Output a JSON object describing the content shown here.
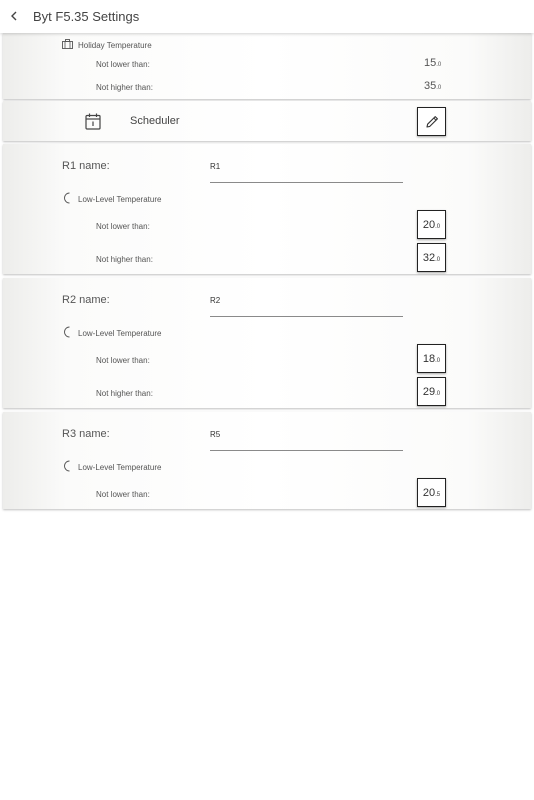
{
  "header": {
    "title": "Byt F5.35 Settings"
  },
  "holiday": {
    "heading": "Holiday Temperature",
    "min_label": "Not lower than:",
    "min_int": "15",
    "min_dec": ".0",
    "max_label": "Not higher than:",
    "max_int": "35",
    "max_dec": ".0"
  },
  "scheduler": {
    "label": "Scheduler"
  },
  "rooms": [
    {
      "name_label": "R1 name:",
      "name_value": "R1",
      "heading": "Low-Level Temperature",
      "min_label": "Not lower than:",
      "min_int": "20",
      "min_dec": ".0",
      "max_label": "Not higher than:",
      "max_int": "32",
      "max_dec": ".0"
    },
    {
      "name_label": "R2 name:",
      "name_value": "R2",
      "heading": "Low-Level Temperature",
      "min_label": "Not lower than:",
      "min_int": "18",
      "min_dec": ".0",
      "max_label": "Not higher than:",
      "max_int": "29",
      "max_dec": ".0"
    },
    {
      "name_label": "R3 name:",
      "name_value": "R5",
      "heading": "Low-Level Temperature",
      "min_label": "Not lower than:",
      "min_int": "20",
      "min_dec": ".5"
    }
  ]
}
